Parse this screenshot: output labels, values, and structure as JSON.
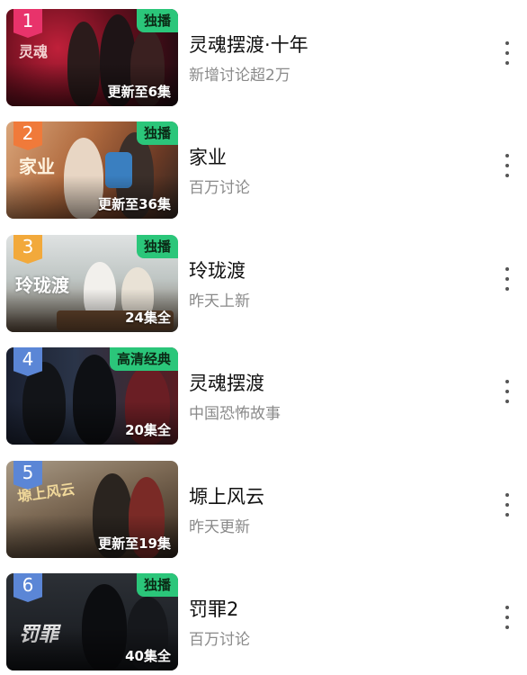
{
  "colors": {
    "exclusive_tag": "#2bc67a",
    "rank_1": "#e8336b",
    "rank_2": "#f07a3a",
    "rank_3": "#f2a93b",
    "rank_other": "#5b86d6"
  },
  "items": [
    {
      "rank": "1",
      "tag": "独播",
      "status": "更新至6集",
      "title": "灵魂摆渡·十年",
      "subtitle": "新增讨论超2万"
    },
    {
      "rank": "2",
      "tag": "独播",
      "status": "更新至36集",
      "title": "家业",
      "subtitle": "百万讨论"
    },
    {
      "rank": "3",
      "tag": "独播",
      "status": "24集全",
      "title": "玲珑渡",
      "subtitle": "昨天上新"
    },
    {
      "rank": "4",
      "tag": "高清经典",
      "status": "20集全",
      "title": "灵魂摆渡",
      "subtitle": "中国恐怖故事"
    },
    {
      "rank": "5",
      "tag": "",
      "status": "更新至19集",
      "title": "塬上风云",
      "subtitle": "昨天更新"
    },
    {
      "rank": "6",
      "tag": "独播",
      "status": "40集全",
      "title": "罚罪2",
      "subtitle": "百万讨论"
    }
  ]
}
